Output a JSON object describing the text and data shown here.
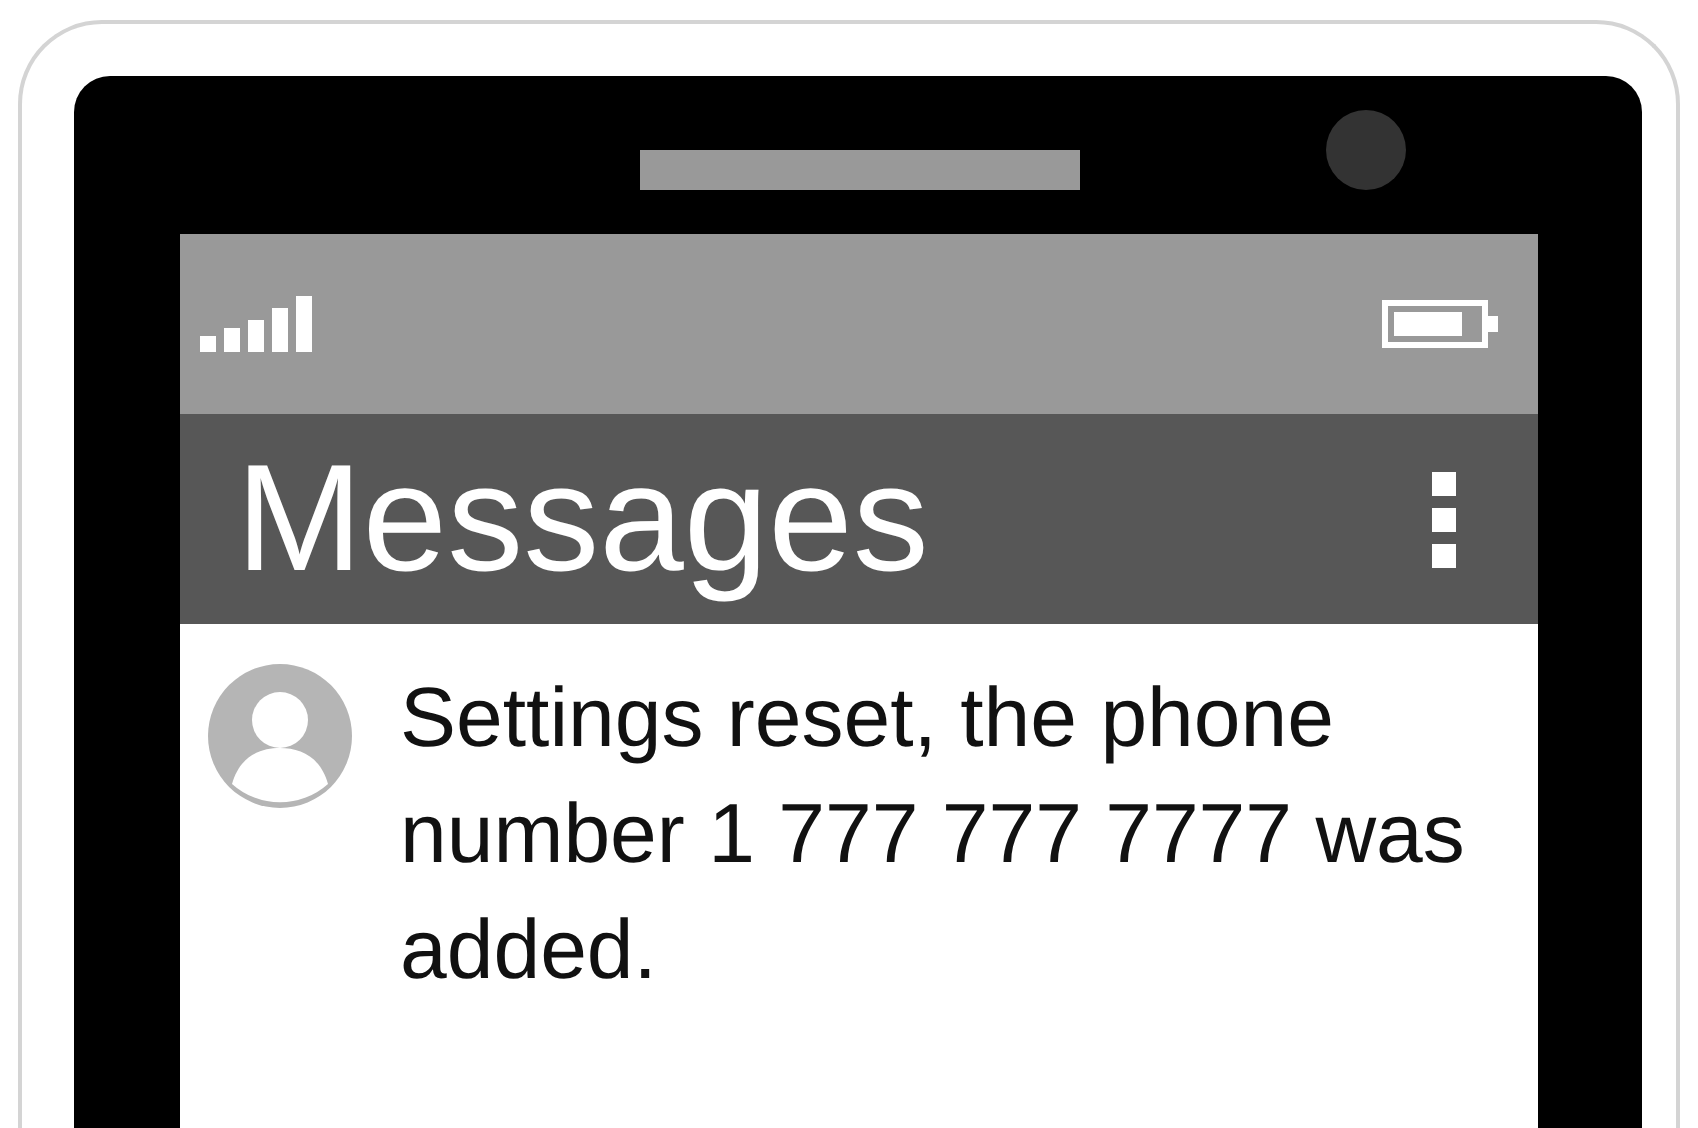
{
  "app_bar": {
    "title": "Messages"
  },
  "messages": [
    {
      "text": "Settings reset, the phone number 1 777 777 7777 was added."
    }
  ]
}
